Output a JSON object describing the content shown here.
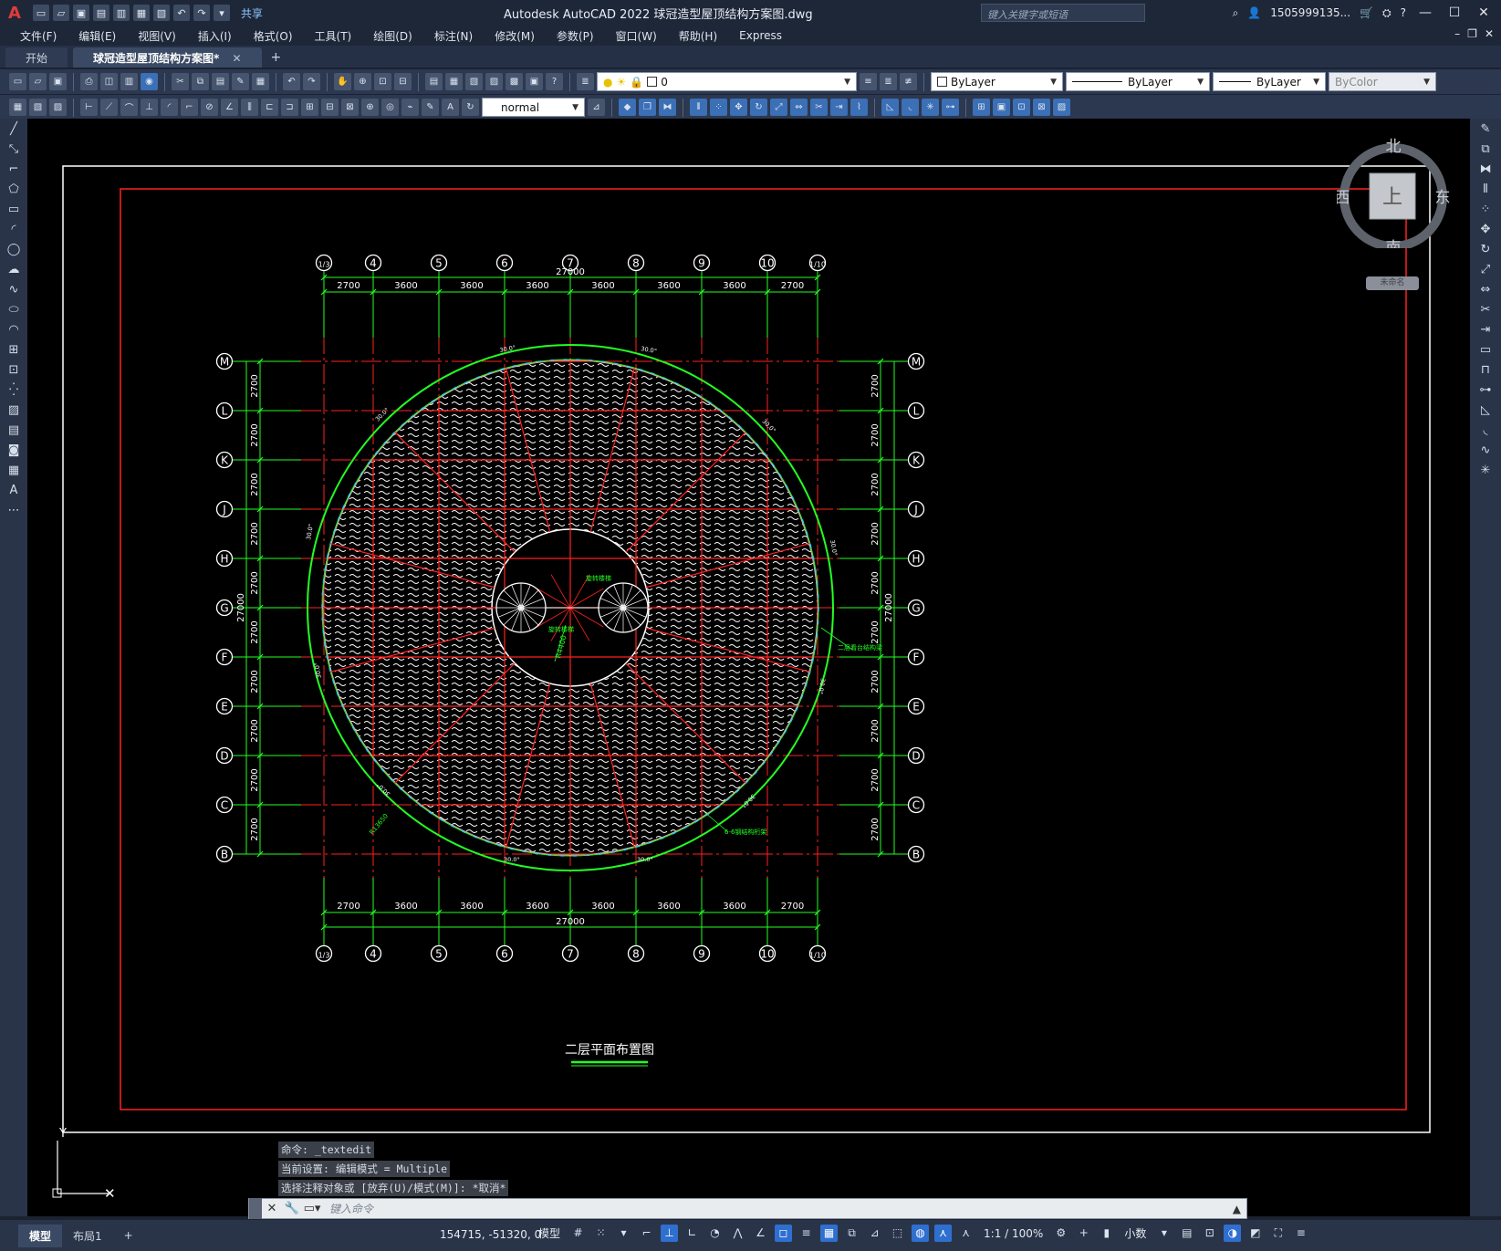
{
  "app": {
    "title": "Autodesk AutoCAD 2022    球冠造型屋顶结构方案图.dwg",
    "share_label": "共享",
    "search_placeholder": "键入关键字或短语",
    "user": "1505999135...",
    "brand_color": "#e23b3b"
  },
  "menu": {
    "items": [
      "文件(F)",
      "编辑(E)",
      "视图(V)",
      "插入(I)",
      "格式(O)",
      "工具(T)",
      "绘图(D)",
      "标注(N)",
      "修改(M)",
      "参数(P)",
      "窗口(W)",
      "帮助(H)",
      "Express"
    ]
  },
  "tabs": {
    "items": [
      {
        "label": "开始"
      },
      {
        "label": "球冠造型屋顶结构方案图*"
      }
    ]
  },
  "toolbar": {
    "layer_value": "0",
    "color_value": "ByLayer",
    "linetype_value": "ByLayer",
    "lineweight_value": "ByLayer",
    "plotstyle_value": "ByColor",
    "dimstyle_value": "normal"
  },
  "viewcube": {
    "north": "北",
    "south": "南",
    "east": "东",
    "west": "西",
    "face": "上",
    "wcs": "未命名"
  },
  "drawing": {
    "top_axes": [
      "1/3",
      "4",
      "5",
      "6",
      "7",
      "8",
      "9",
      "10",
      "1/10"
    ],
    "side_axes": [
      "M",
      "L",
      "K",
      "J",
      "H",
      "G",
      "F",
      "E",
      "D",
      "C",
      "B"
    ],
    "col_dims": [
      "2700",
      "3600",
      "3600",
      "3600",
      "3600",
      "3600",
      "3600",
      "2700"
    ],
    "row_dim": "2700",
    "overall_dim": "27000",
    "angle_label": "30.0°",
    "caption": "二层平面布置图",
    "stair_label_1": "旋转楼梯",
    "stair_label_2": "旋转楼梯",
    "radius_label": "R4400",
    "r_outer_label": "R13650",
    "annotation_right": "二层看台结构梁",
    "annotation_br": "6-6钢结构桁架",
    "colors": {
      "grid_green": "#22ff22",
      "red": "#ff2020",
      "white": "#ffffff",
      "cyan": "#00d8ff"
    }
  },
  "command": {
    "history": [
      "命令: _textedit",
      "当前设置: 编辑模式 = Multiple",
      "选择注释对象或 [放弃(U)/模式(M)]: *取消*"
    ],
    "placeholder": "键入命令"
  },
  "status": {
    "model_tab": "模型",
    "layout_tab": "布局1",
    "coordinates": "154715, -51320, 0",
    "model_label": "模型",
    "scale": "1:1 / 100%",
    "units": "小数"
  }
}
